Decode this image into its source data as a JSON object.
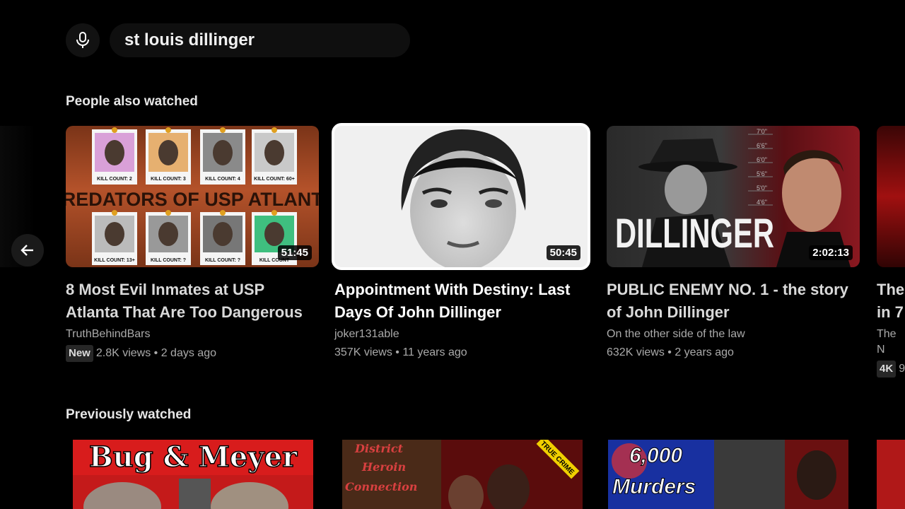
{
  "search": {
    "query": "st louis dillinger",
    "mic_icon": "microphone-icon"
  },
  "shelves": [
    {
      "title": "People also watched",
      "cards": [
        {
          "title_line1": "8 Most Evil Inmates at USP",
          "title_line2": "Atlanta That Are Too Dangerous",
          "channel": "TruthBehindBars",
          "badge": "New",
          "meta": "2.8K views • 2 days ago",
          "duration": "51:45",
          "thumb_text": "PREDATORS OF USP ATLANTA",
          "kill_labels": [
            "KILL COUNT: 2",
            "KILL COUNT: 3",
            "KILL COUNT: 4",
            "KILL COUNT: 60+",
            "KILL COUNT: 13+",
            "KILL COUNT: ?",
            "KILL COUNT: ?",
            "KILL COUNT"
          ]
        },
        {
          "title_line1": "Appointment With Destiny: Last",
          "title_line2": "Days Of John Dillinger",
          "channel": "joker131able",
          "badge": "",
          "meta": "357K views • 11 years ago",
          "duration": "50:45"
        },
        {
          "title_line1": "PUBLIC ENEMY NO. 1 - the story",
          "title_line2": "of John Dillinger",
          "channel": "On the other side of the law",
          "badge": "",
          "meta": "632K views • 2 years ago",
          "duration": "2:02:13",
          "thumb_text": "DILLINGER",
          "height_marks": [
            "7'0\"",
            "6'6\"",
            "6'0\"",
            "5'6\"",
            "5'0\"",
            "4'6\""
          ]
        },
        {
          "title_line1": "The",
          "title_line2": "in 7",
          "channel": "The N",
          "badge": "4K",
          "meta": "9"
        }
      ]
    },
    {
      "title": "Previously watched",
      "cards": [
        {
          "thumb_text": "Bug & Meyer"
        },
        {
          "thumb_text_lines": [
            "District",
            "Heroin",
            "Connection"
          ],
          "tag": "TRUE CRIME"
        },
        {
          "thumb_text_lines": [
            "6,000",
            "Murders"
          ]
        }
      ]
    }
  ],
  "nav": {
    "back_icon": "arrow-left-icon"
  },
  "colors": {
    "background": "#000000",
    "focus_outline": "#ffffff",
    "secondary_text": "#aaaaaa"
  }
}
